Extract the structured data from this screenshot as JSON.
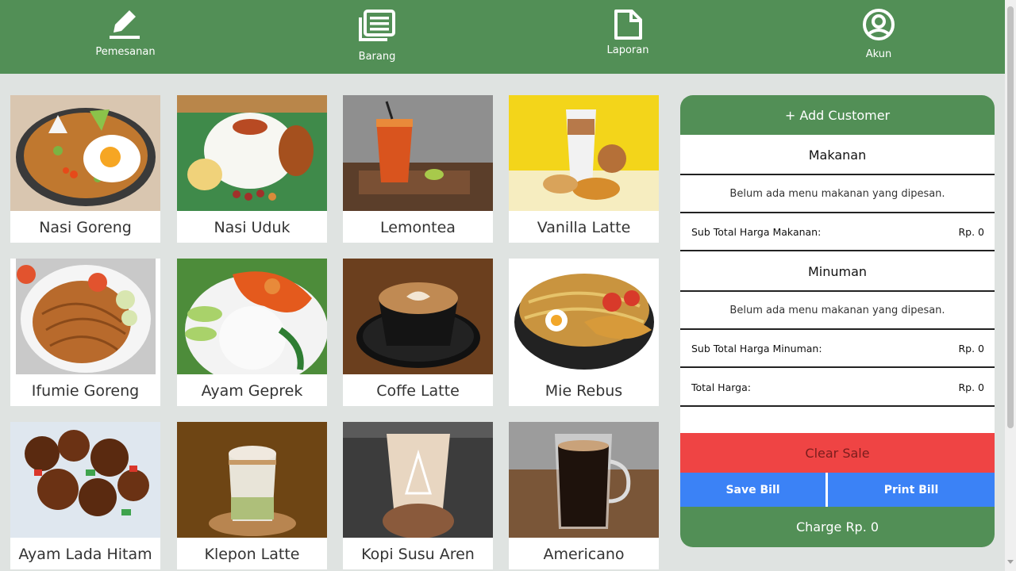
{
  "nav": {
    "items": [
      {
        "label": "Pemesanan",
        "icon": "pencil-icon"
      },
      {
        "label": "Barang",
        "icon": "documents-icon"
      },
      {
        "label": "Laporan",
        "icon": "file-icon"
      },
      {
        "label": "Akun",
        "icon": "account-icon"
      }
    ]
  },
  "products": [
    {
      "name": "Nasi Goreng"
    },
    {
      "name": "Nasi Uduk"
    },
    {
      "name": "Lemontea"
    },
    {
      "name": "Vanilla Latte"
    },
    {
      "name": "Ifumie Goreng"
    },
    {
      "name": "Ayam Geprek"
    },
    {
      "name": "Coffe Latte"
    },
    {
      "name": "Mie Rebus"
    },
    {
      "name": "Ayam Lada Hitam"
    },
    {
      "name": "Klepon Latte"
    },
    {
      "name": "Kopi Susu Aren"
    },
    {
      "name": "Americano"
    }
  ],
  "order": {
    "add_customer": "+ Add Customer",
    "food_title": "Makanan",
    "food_empty": "Belum ada menu makanan yang dipesan.",
    "food_subtotal_label": "Sub Total Harga Makanan:",
    "food_subtotal_value": "Rp. 0",
    "drink_title": "Minuman",
    "drink_empty": "Belum ada menu makanan yang dipesan.",
    "drink_subtotal_label": "Sub Total Harga Minuman:",
    "drink_subtotal_value": "Rp. 0",
    "total_label": "Total Harga:",
    "total_value": "Rp. 0",
    "clear_sale": "Clear Sale",
    "save_bill": "Save Bill",
    "print_bill": "Print Bill",
    "charge": "Charge Rp. 0"
  },
  "colors": {
    "brand_green": "#528f56",
    "danger_red": "#ef4444",
    "primary_blue": "#3b82f6",
    "page_background": "#dfe3e1"
  }
}
